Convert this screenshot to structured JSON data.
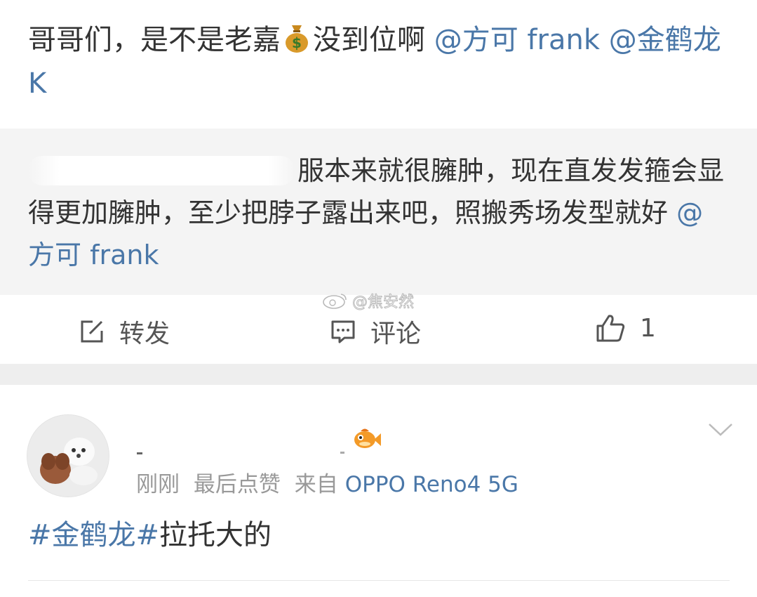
{
  "post": {
    "text_before": "哥哥们，是不是老嘉",
    "emoji": "money-bag",
    "text_after": "没到位啊",
    "mentions": [
      "@方可 frank",
      "@金鹤龙 K"
    ]
  },
  "quote": {
    "text": "服本来就很臃肿，现在直发发箍会显得更加臃肿，至少把脖子露出来吧，照搬秀场发型就好",
    "mention": "@方可 frank"
  },
  "watermark": "@焦安然",
  "actions": {
    "repost_label": "转发",
    "comment_label": "评论",
    "like_count": "1"
  },
  "comment": {
    "time": "刚刚",
    "last_like": "最后点赞",
    "source_prefix": "来自",
    "device": "OPPO Reno4 5G",
    "topic": "#金鹤龙#",
    "text": "拉托大的"
  },
  "colors": {
    "link": "#4a77a8",
    "text": "#333333",
    "meta": "#999999",
    "quote_bg": "#f4f4f4"
  }
}
